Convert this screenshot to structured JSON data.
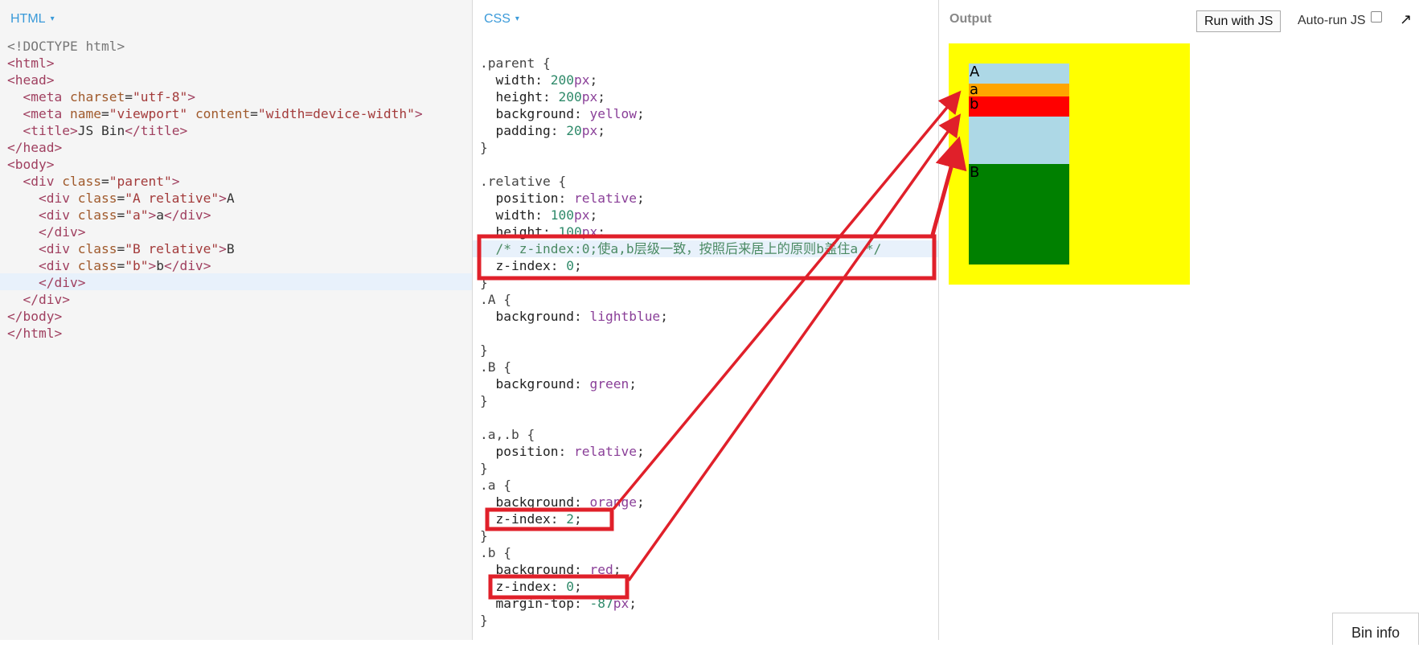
{
  "panels": {
    "html": {
      "title": "HTML"
    },
    "css": {
      "title": "CSS"
    },
    "output": {
      "title": "Output"
    }
  },
  "toolbar": {
    "run_label": "Run with JS",
    "autorun_label": "Auto-run JS",
    "autorun_checked": false,
    "expand_icon": "expand-arrow-icon",
    "bin_info_label": "Bin info"
  },
  "html_code": [
    "<!DOCTYPE html>",
    "<html>",
    "<head>",
    "  <meta charset=\"utf-8\">",
    "  <meta name=\"viewport\" content=\"width=device-width\">",
    "  <title>JS Bin</title>",
    "</head>",
    "<body>",
    "  <div class=\"parent\">",
    "    <div class=\"A relative\">A",
    "    <div class=\"a\">a</div>",
    "    </div>",
    "    <div class=\"B relative\">B",
    "    <div class=\"b\">b</div>",
    "    </div>",
    "  </div>",
    "</body>",
    "</html>"
  ],
  "css_code": [
    ".parent {",
    "  width: 200px;",
    "  height: 200px;",
    "  background: yellow;",
    "  padding: 20px;",
    "}",
    "",
    ".relative {",
    "  position: relative;",
    "  width: 100px;",
    "  height: 100px;",
    "  /* z-index:0;使a,b层级一致，按照后来居上的原则b盖住a */",
    "  z-index: 0;",
    "}",
    ".A {",
    "  background: lightblue;",
    "",
    "}",
    ".B {",
    "  background: green;",
    "}",
    "",
    ".a,.b {",
    "  position: relative;",
    "}",
    ".a {",
    "  background: orange;",
    "  z-index: 2;",
    "}",
    ".b {",
    "  background: red;",
    "  z-index: 0;",
    "  margin-top: -87px;",
    "}"
  ],
  "output_demo": {
    "colors": {
      "parent": "#ffff00",
      "A": "#add8e6",
      "a": "#ffa500",
      "b": "#ff0000",
      "B": "#008000"
    },
    "labels": {
      "A": "A",
      "a": "a",
      "b": "b",
      "B": "B"
    }
  },
  "annotation_color": "#e0202a"
}
